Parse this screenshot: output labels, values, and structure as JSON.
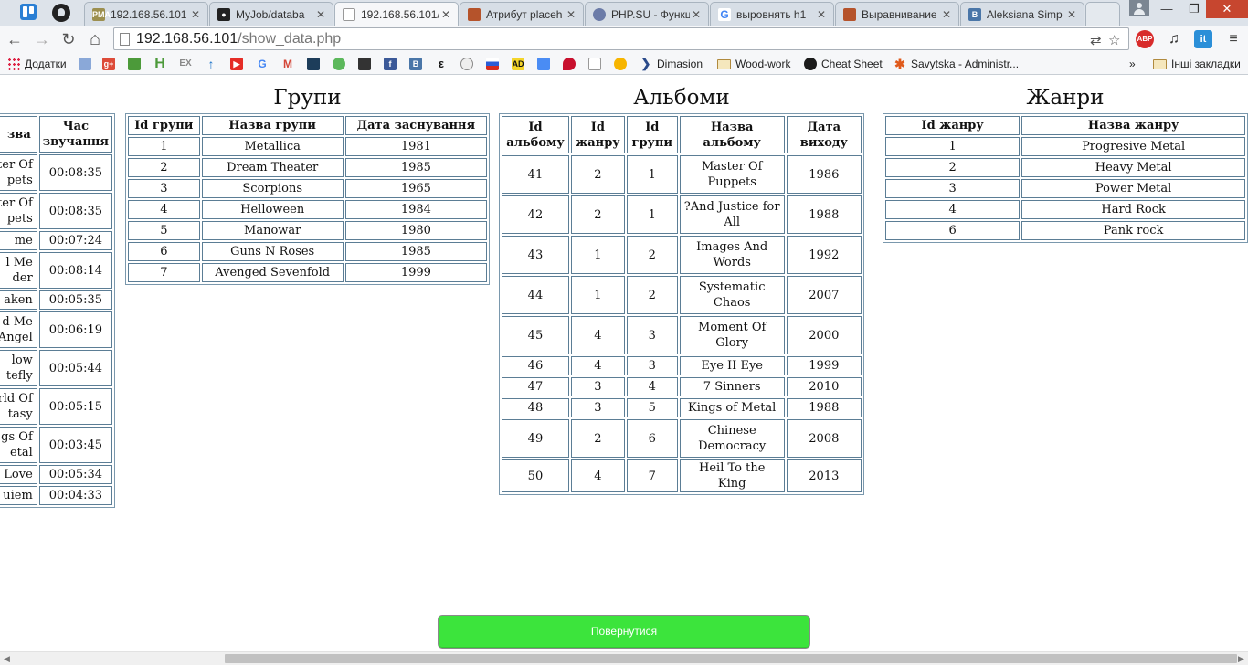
{
  "browser": {
    "tabs": [
      {
        "title": "192.168.56.101",
        "favicon": "phpmyadmin-icon",
        "color": "#9c8f4f"
      },
      {
        "title": "MyJob/databa",
        "favicon": "github-icon",
        "color": "#222222"
      },
      {
        "title": "192.168.56.101/",
        "favicon": "page-icon",
        "color": "#ffffff",
        "active": true
      },
      {
        "title": "Атрибут placeh",
        "favicon": "htmlbook-icon",
        "color": "#b5532b"
      },
      {
        "title": "PHP.SU - Функц",
        "favicon": "php-icon",
        "color": "#6b7ba8"
      },
      {
        "title": "выровнять h1",
        "favicon": "google-icon",
        "color": "#4285f4"
      },
      {
        "title": "Выравнивание",
        "favicon": "htmlbook-icon",
        "color": "#b5532b"
      },
      {
        "title": "Aleksiana Simp",
        "favicon": "vk-icon",
        "color": "#4a76a8"
      }
    ],
    "address": {
      "host": "192.168.56.101",
      "path": "/show_data.php"
    },
    "window_controls": {
      "minimize": "—",
      "maximize": "❐",
      "close": "✕"
    },
    "nav": {
      "back": "←",
      "forward": "→",
      "reload": "↻",
      "home": "⌂"
    },
    "bookmarks": [
      {
        "label": "Додатки",
        "icon": "apps-icon"
      },
      {
        "label": "Dimasion",
        "icon": "chevron-icon"
      },
      {
        "label": "Wood-work",
        "icon": "folder-icon"
      },
      {
        "label": "Cheat Sheet",
        "icon": "cheat-sheet-icon"
      },
      {
        "label": "Savytska - Administr...",
        "icon": "savytska-icon"
      }
    ],
    "bookmarks_more": "»",
    "other_bookmarks": "Інші закладки"
  },
  "tables": {
    "songs": {
      "headers": [
        "зва",
        "Час звучання"
      ],
      "rows": [
        [
          "ter Of\npets",
          "00:08:35"
        ],
        [
          "ter Of\npets",
          "00:08:35"
        ],
        [
          "me",
          "00:07:24"
        ],
        [
          "l Me\nder",
          "00:08:14"
        ],
        [
          "aken",
          "00:05:35"
        ],
        [
          "d Me\nAngel",
          "00:06:19"
        ],
        [
          "low\ntefly",
          "00:05:44"
        ],
        [
          "rld Of\ntasy",
          "00:05:15"
        ],
        [
          "gs Of\netal",
          "00:03:45"
        ],
        [
          "l Love",
          "00:05:34"
        ],
        [
          "uiem",
          "00:04:33"
        ]
      ]
    },
    "groups": {
      "title": "Групи",
      "headers": [
        "Id групи",
        "Назва групи",
        "Дата заснування"
      ],
      "rows": [
        [
          "1",
          "Metallica",
          "1981"
        ],
        [
          "2",
          "Dream Theater",
          "1985"
        ],
        [
          "3",
          "Scorpions",
          "1965"
        ],
        [
          "4",
          "Helloween",
          "1984"
        ],
        [
          "5",
          "Manowar",
          "1980"
        ],
        [
          "6",
          "Guns N Roses",
          "1985"
        ],
        [
          "7",
          "Avenged Sevenfold",
          "1999"
        ]
      ]
    },
    "albums": {
      "title": "Альбоми",
      "headers": [
        "Id альбому",
        "Id жанру",
        "Id групи",
        "Назва альбому",
        "Дата виходу"
      ],
      "rows": [
        [
          "41",
          "2",
          "1",
          "Master Of Puppets",
          "1986"
        ],
        [
          "42",
          "2",
          "1",
          "?And Justice for All",
          "1988"
        ],
        [
          "43",
          "1",
          "2",
          "Images And Words",
          "1992"
        ],
        [
          "44",
          "1",
          "2",
          "Systematic Chaos",
          "2007"
        ],
        [
          "45",
          "4",
          "3",
          "Moment Of Glory",
          "2000"
        ],
        [
          "46",
          "4",
          "3",
          "Eye II Eye",
          "1999"
        ],
        [
          "47",
          "3",
          "4",
          "7 Sinners",
          "2010"
        ],
        [
          "48",
          "3",
          "5",
          "Kings of Metal",
          "1988"
        ],
        [
          "49",
          "2",
          "6",
          "Chinese Democracy",
          "2008"
        ],
        [
          "50",
          "4",
          "7",
          "Heil To the King",
          "2013"
        ]
      ]
    },
    "genres": {
      "title": "Жанри",
      "headers": [
        "Id жанру",
        "Назва жанру"
      ],
      "rows": [
        [
          "1",
          "Progresive Metal"
        ],
        [
          "2",
          "Heavy Metal"
        ],
        [
          "3",
          "Power Metal"
        ],
        [
          "4",
          "Hard Rock"
        ],
        [
          "6",
          "Pank rock"
        ]
      ]
    }
  },
  "back_button": {
    "label": "Повернутися",
    "color": "#3ce43c"
  }
}
